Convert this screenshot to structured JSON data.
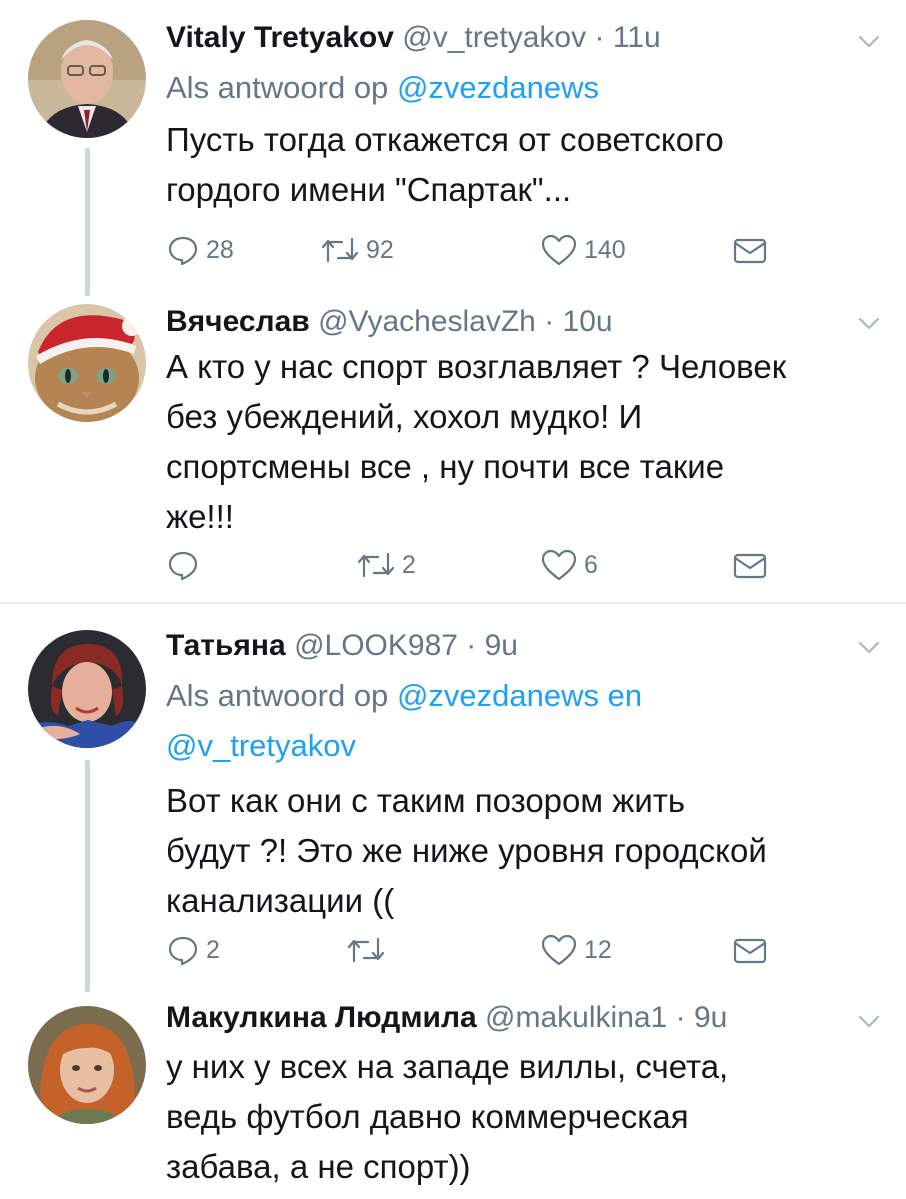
{
  "tweets": [
    {
      "name": "Vitaly Tretyakov",
      "handle": "@v_tretyakov",
      "time": "11u",
      "replying_prefix": "Als antwoord op",
      "replying_to": "@zvezdanews",
      "replying_and": "",
      "replying_to2": "",
      "lines": [
        "Пусть тогда откажется от советского",
        "гордого имени \"Спартак\"..."
      ],
      "replies": "28",
      "retweets": "92",
      "likes": "140"
    },
    {
      "name": "Вячеслав",
      "handle": "@VyacheslavZh",
      "time": "10u",
      "lines": [
        "А кто у нас спорт возглавляет ? Человек",
        "без убеждений, хохол мудко! И",
        "спортсмены все , ну почти все такие",
        "же!!!"
      ],
      "replies": "",
      "retweets": "2",
      "likes": "6"
    },
    {
      "name": "Татьяна",
      "handle": "@LOOK987",
      "time": "9u",
      "replying_prefix": "Als antwoord op",
      "replying_to": "@zvezdanews",
      "replying_and": "en",
      "replying_to2": "@v_tretyakov",
      "lines": [
        "Вот как они с таким позором жить",
        "будут ?! Это же ниже уровня городской",
        "канализации (("
      ],
      "replies": "2",
      "retweets": "",
      "likes": "12"
    },
    {
      "name": "Макулкина Людмила",
      "handle": "@makulkina1",
      "time": "9u",
      "lines": [
        "у них у всех на западе виллы, счета,",
        "ведь футбол давно коммерческая",
        "забава, а не спорт))"
      ]
    }
  ],
  "separator": "·",
  "icons": {
    "reply": "reply-bubble-icon",
    "retweet": "retweet-icon",
    "like": "heart-icon",
    "dm": "envelope-icon",
    "more": "chevron-down-icon"
  },
  "colors": {
    "text": "#14171a",
    "secondary": "#657786",
    "link": "#1da1f2",
    "thread_line": "#ccd6dd",
    "divider": "#e6ecf0"
  }
}
